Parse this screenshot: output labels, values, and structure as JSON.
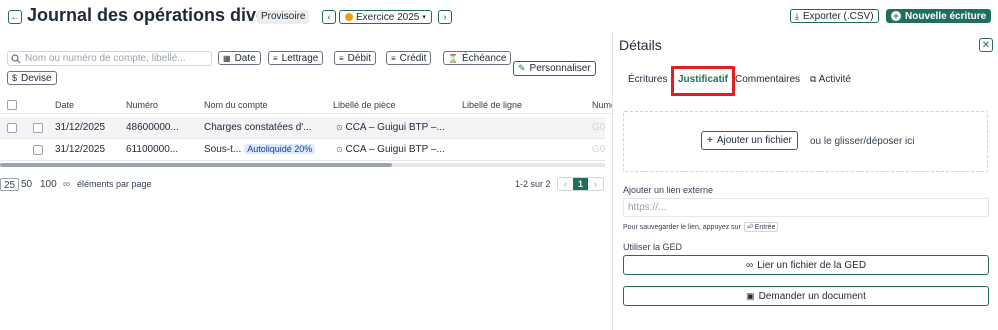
{
  "header": {
    "title": "Journal des opérations diverses",
    "status": "Provisoire",
    "exercise": "Exercice 2025",
    "export_label": "Exporter (.CSV)",
    "new_entry_label": "Nouvelle écriture"
  },
  "toolbar": {
    "search_placeholder": "Nom ou numéro de compte, libellé...",
    "filters": [
      "Date",
      "Lettrage",
      "Débit",
      "Crédit",
      "Échéance"
    ],
    "devise_label": "Devise",
    "customize_label": "Personnaliser"
  },
  "table": {
    "columns": [
      "Date",
      "Numéro",
      "Nom du compte",
      "Libellé de pièce",
      "Libellé de ligne",
      "Numé"
    ],
    "rows": [
      {
        "date": "31/12/2025",
        "numero": "48600000...",
        "compte": "Charges constatées d'...",
        "piece": "CCA – Guigui BTP –...",
        "ligne": "",
        "extra": "G0"
      },
      {
        "date": "31/12/2025",
        "numero": "61100000...",
        "compte": "Sous-t...",
        "tag": "Autoliquidé 20%",
        "piece": "CCA – Guigui BTP –...",
        "ligne": "",
        "extra": "G0"
      }
    ]
  },
  "pagination": {
    "sizes": [
      "25",
      "50",
      "100",
      "∞"
    ],
    "per_page_label": "éléments par page",
    "range": "1-2 sur 2",
    "current_page": "1"
  },
  "details": {
    "title": "Détails",
    "tabs": [
      "Écritures",
      "Justificatif",
      "Commentaires",
      "Activité"
    ],
    "add_file_label": "Ajouter un fichier",
    "drop_hint": "ou le glisser/déposer ici",
    "external_link_label": "Ajouter un lien externe",
    "url_placeholder": "https://...",
    "save_hint": "Pour sauvegarder le lien, appuyez sur",
    "enter_key": "⏎ Entrée",
    "ged_label": "Utiliser la GED",
    "link_ged_label": "Lier un fichier de la GED",
    "request_doc_label": "Demander un document"
  },
  "colors": {
    "accent": "#1f6f5c",
    "highlight": "#e02020",
    "warning_dot": "#f59e0b"
  }
}
